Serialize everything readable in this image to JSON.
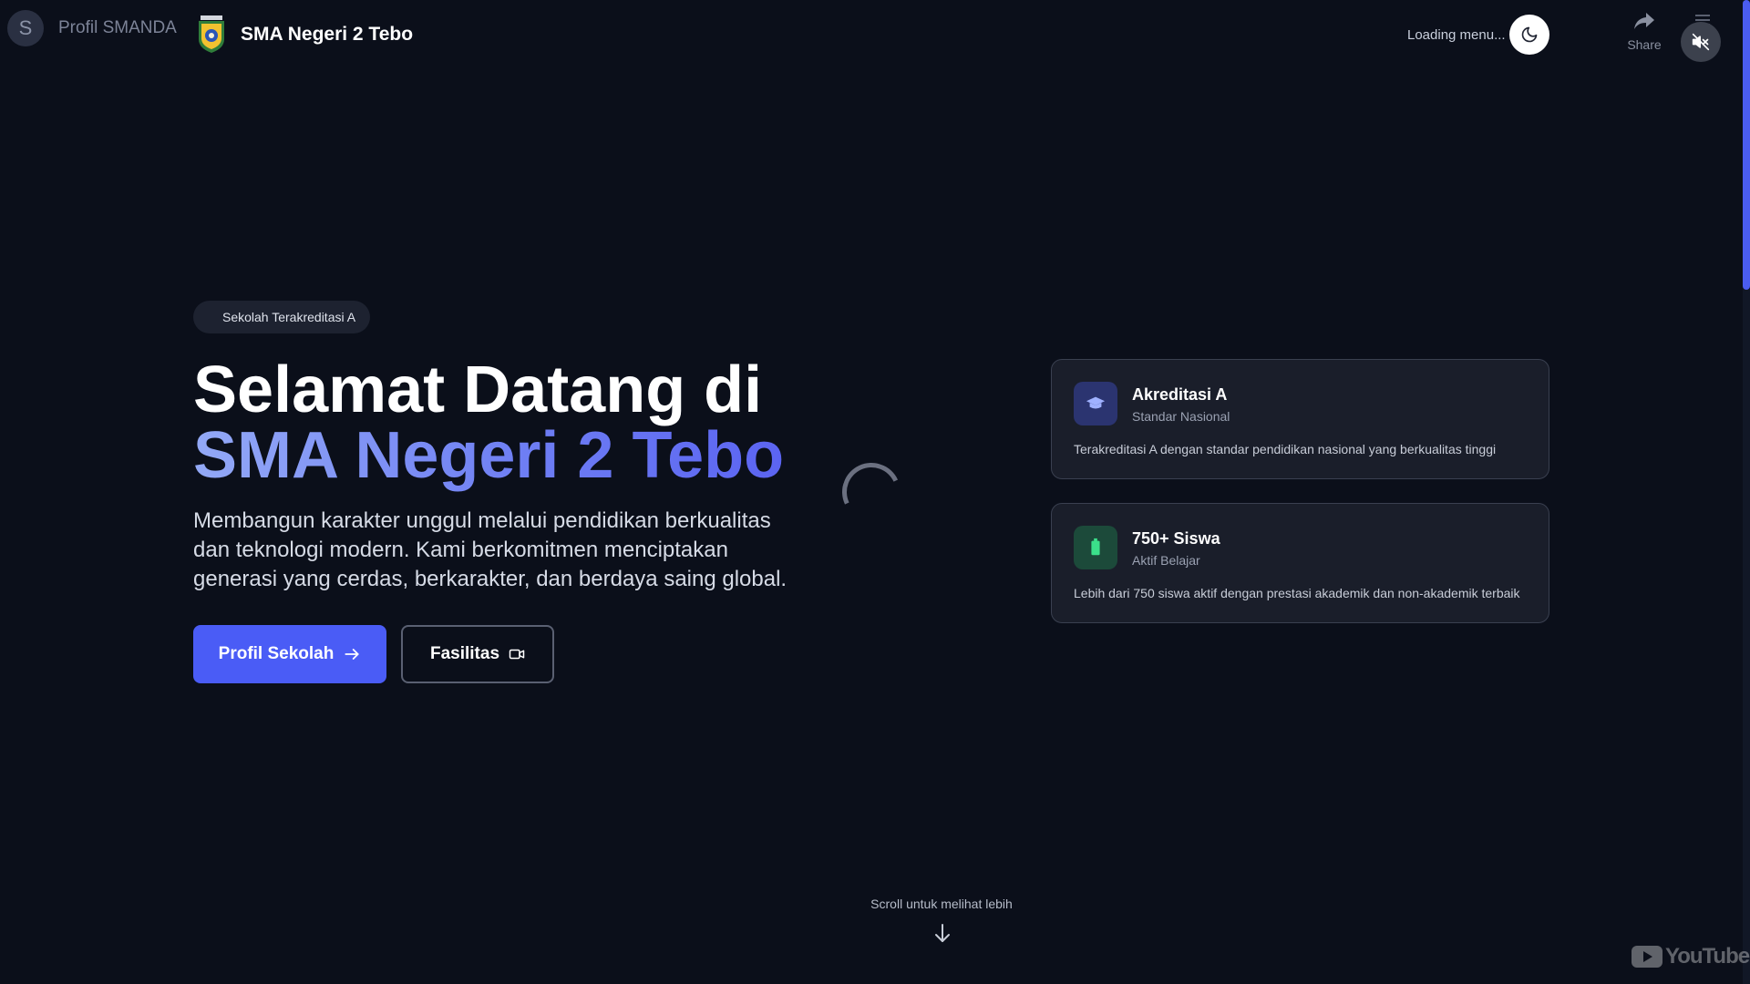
{
  "overlay": {
    "avatar_letter": "S",
    "channel_name": "Profil SMANDA",
    "share_label": "Share",
    "youtube_logo_text": "YouTube"
  },
  "header": {
    "site_title": "SMA Negeri 2 Tebo",
    "loading_menu": "Loading menu..."
  },
  "hero": {
    "badge": "Sekolah Terakreditasi A",
    "title_line1": "Selamat Datang di",
    "title_line2": "SMA Negeri 2 Tebo",
    "description": "Membangun karakter unggul melalui pendidikan berkualitas dan teknologi modern. Kami berkomitmen menciptakan generasi yang cerdas, berkarakter, dan berdaya saing global.",
    "primary_button": "Profil Sekolah",
    "secondary_button": "Fasilitas"
  },
  "cards": [
    {
      "title": "Akreditasi A",
      "subtitle": "Standar Nasional",
      "description": "Terakreditasi A dengan standar pendidikan nasional yang berkualitas tinggi",
      "icon": "graduation-cap-icon",
      "accent": "#2b3470"
    },
    {
      "title": "750+ Siswa",
      "subtitle": "Aktif Belajar",
      "description": "Lebih dari 750 siswa aktif dengan prestasi akademik dan non-akademik terbaik",
      "icon": "users-icon",
      "accent": "#1c4a3a"
    }
  ],
  "scroll_hint": "Scroll untuk melihat lebih",
  "colors": {
    "background": "#0b0f1a",
    "primary": "#4a5cf6",
    "gradient_start": "#93a9f6",
    "gradient_end": "#5b64f1"
  }
}
